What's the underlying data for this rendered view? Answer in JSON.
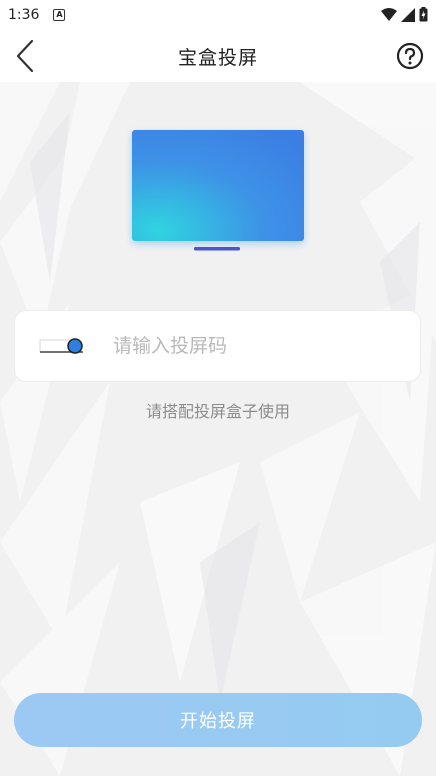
{
  "status_bar": {
    "time": "1:36",
    "notification_icon": "a-badge-icon",
    "icons": [
      "wifi-icon",
      "signal-icon",
      "battery-icon"
    ]
  },
  "header": {
    "title": "宝盒投屏",
    "back_icon": "chevron-left-icon",
    "help_icon": "question-circle-icon"
  },
  "illustration": {
    "icon": "tv-screen-illustration"
  },
  "input": {
    "placeholder": "请输入投屏码",
    "value": "",
    "icon": "key-icon"
  },
  "hint": "请搭配投屏盒子使用",
  "start_button": {
    "label": "开始投屏"
  },
  "colors": {
    "accent_blue": "#3a86e0",
    "button_bg": "#9cc9f4",
    "page_bg": "#f2f2f3"
  }
}
